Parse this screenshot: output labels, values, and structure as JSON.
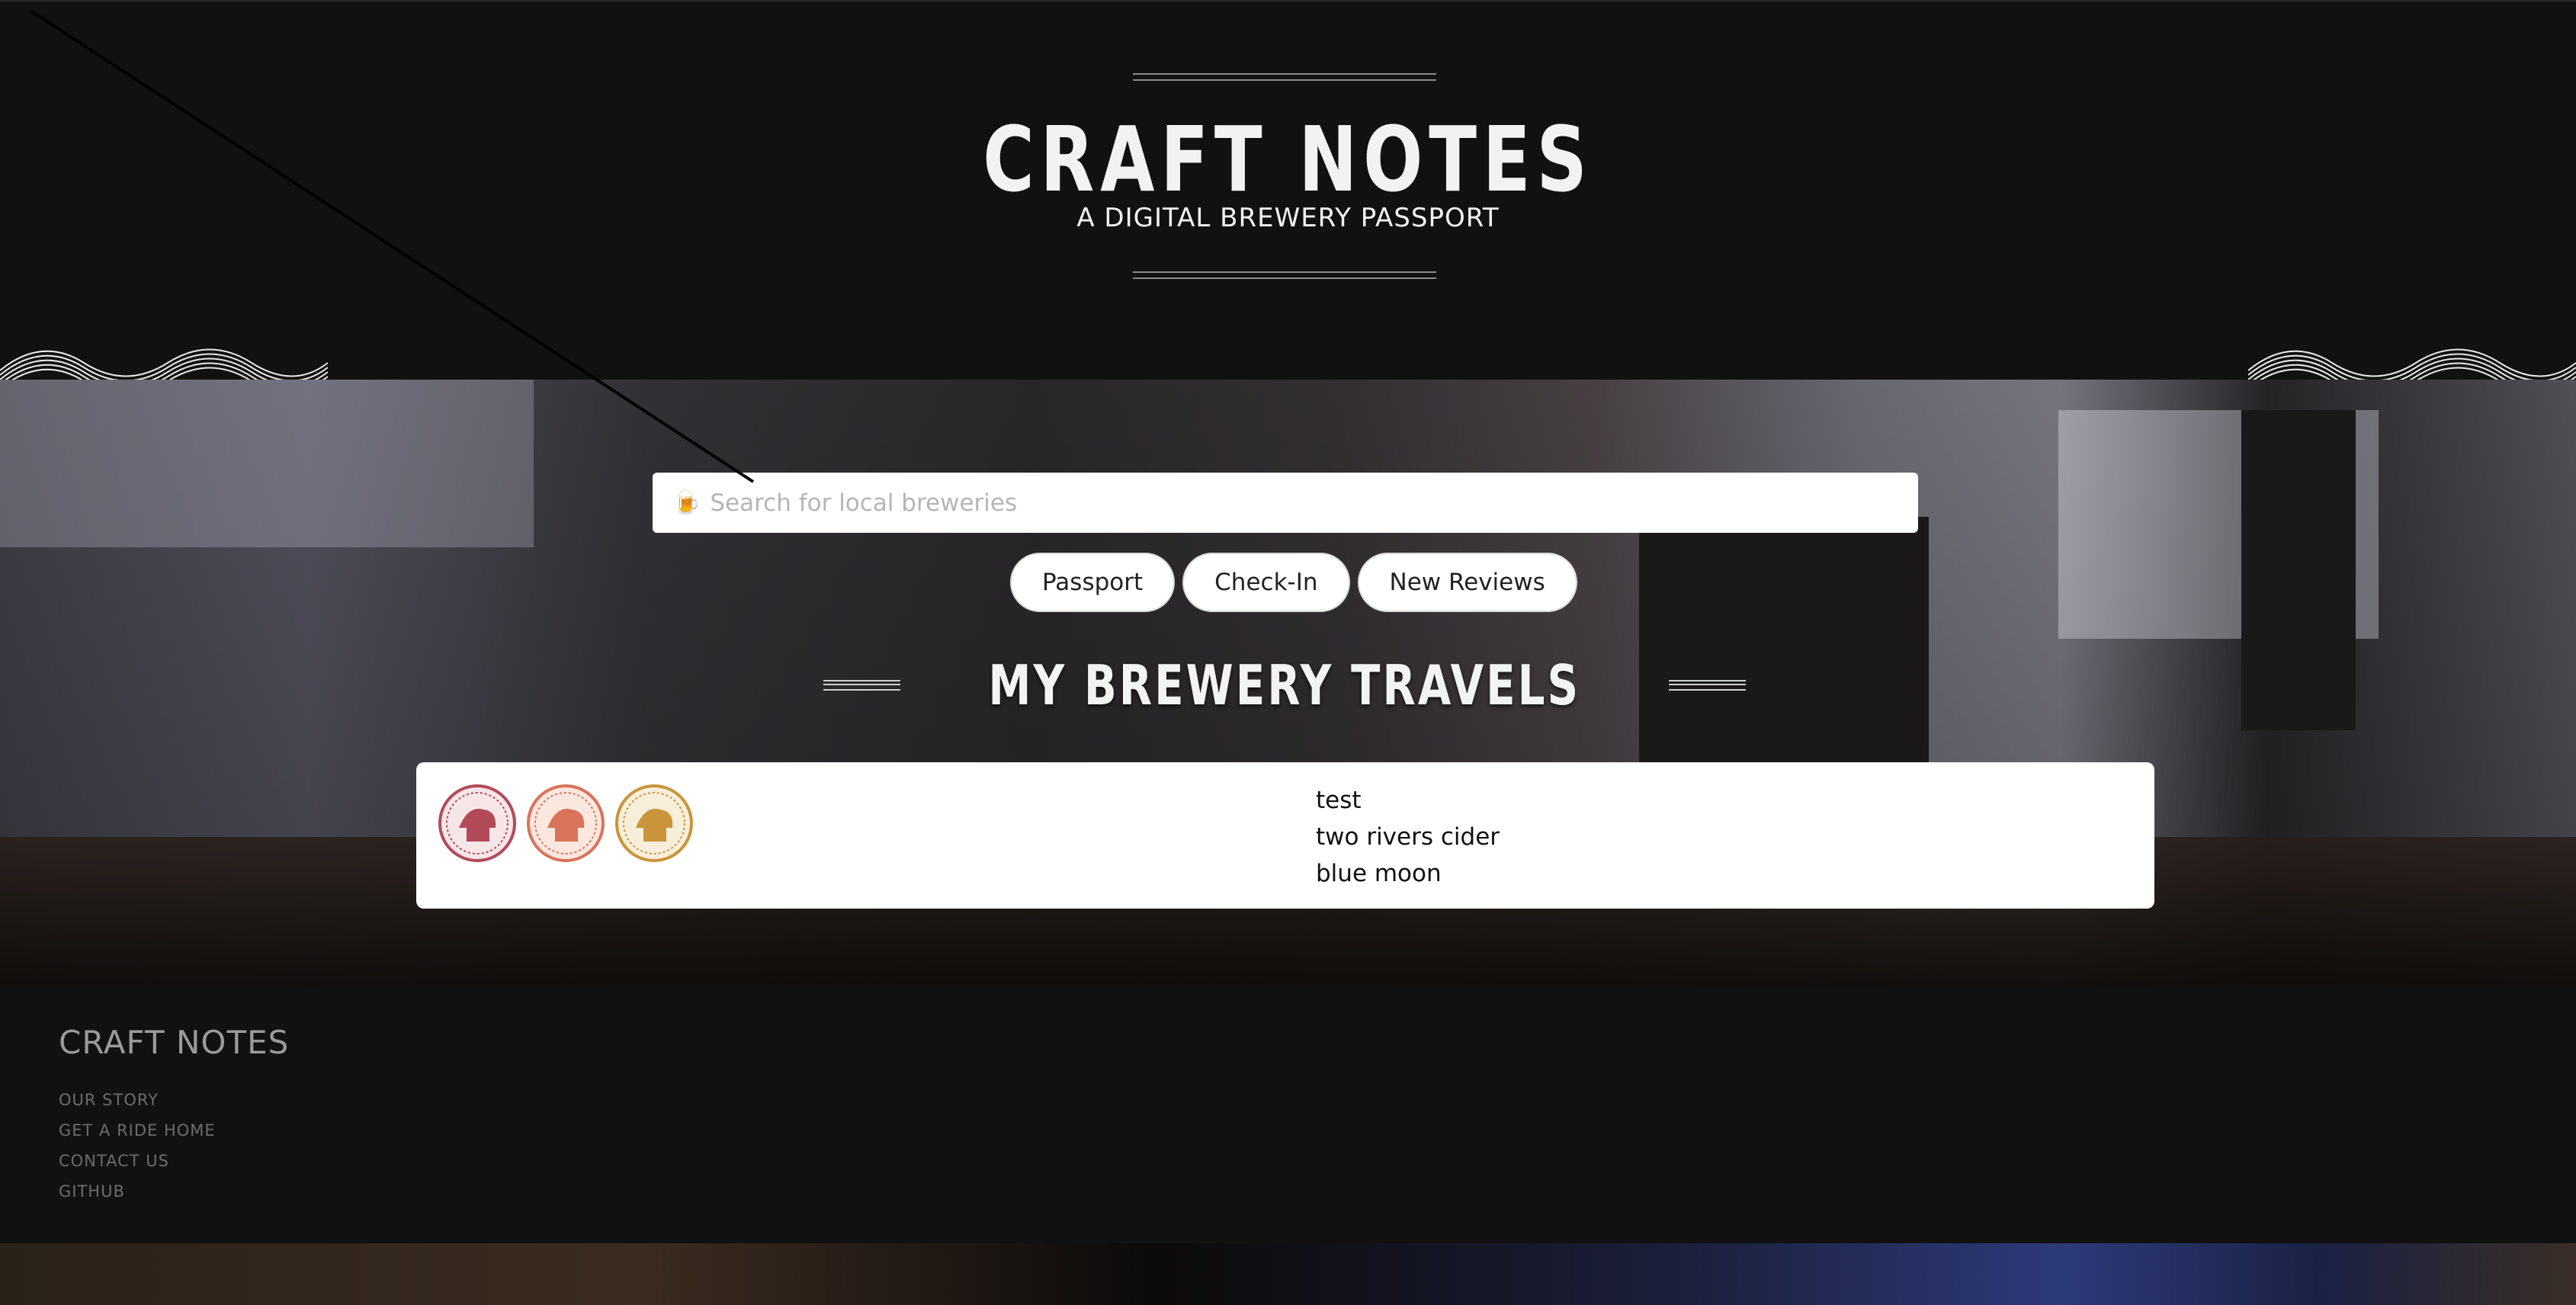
{
  "header": {
    "title": "CRAFT NOTES",
    "subtitle": "A DIGITAL BREWERY PASSPORT"
  },
  "search": {
    "placeholder": "Search for local breweries",
    "icon": "beer-mug-icon"
  },
  "tabs": [
    {
      "label": "Passport"
    },
    {
      "label": "Check-In"
    },
    {
      "label": "New Reviews"
    }
  ],
  "travels": {
    "heading": "MY BREWERY TRAVELS",
    "stamps": [
      {
        "icon": "brewery-stamp-icon",
        "color": "#b24a5a"
      },
      {
        "icon": "brewery-stamp-icon",
        "color": "#d9735a"
      },
      {
        "icon": "brewery-stamp-icon",
        "color": "#c9943a"
      }
    ],
    "reviews": [
      "test",
      "two rivers cider",
      "blue moon"
    ]
  },
  "footer": {
    "title": "CRAFT NOTES",
    "links": [
      "OUR STORY",
      "GET A RIDE HOME",
      "CONTACT US",
      "GITHUB"
    ]
  },
  "colors": {
    "background": "#111111",
    "text_light": "#f2f2f2",
    "footer_link": "#6c6c6c"
  }
}
